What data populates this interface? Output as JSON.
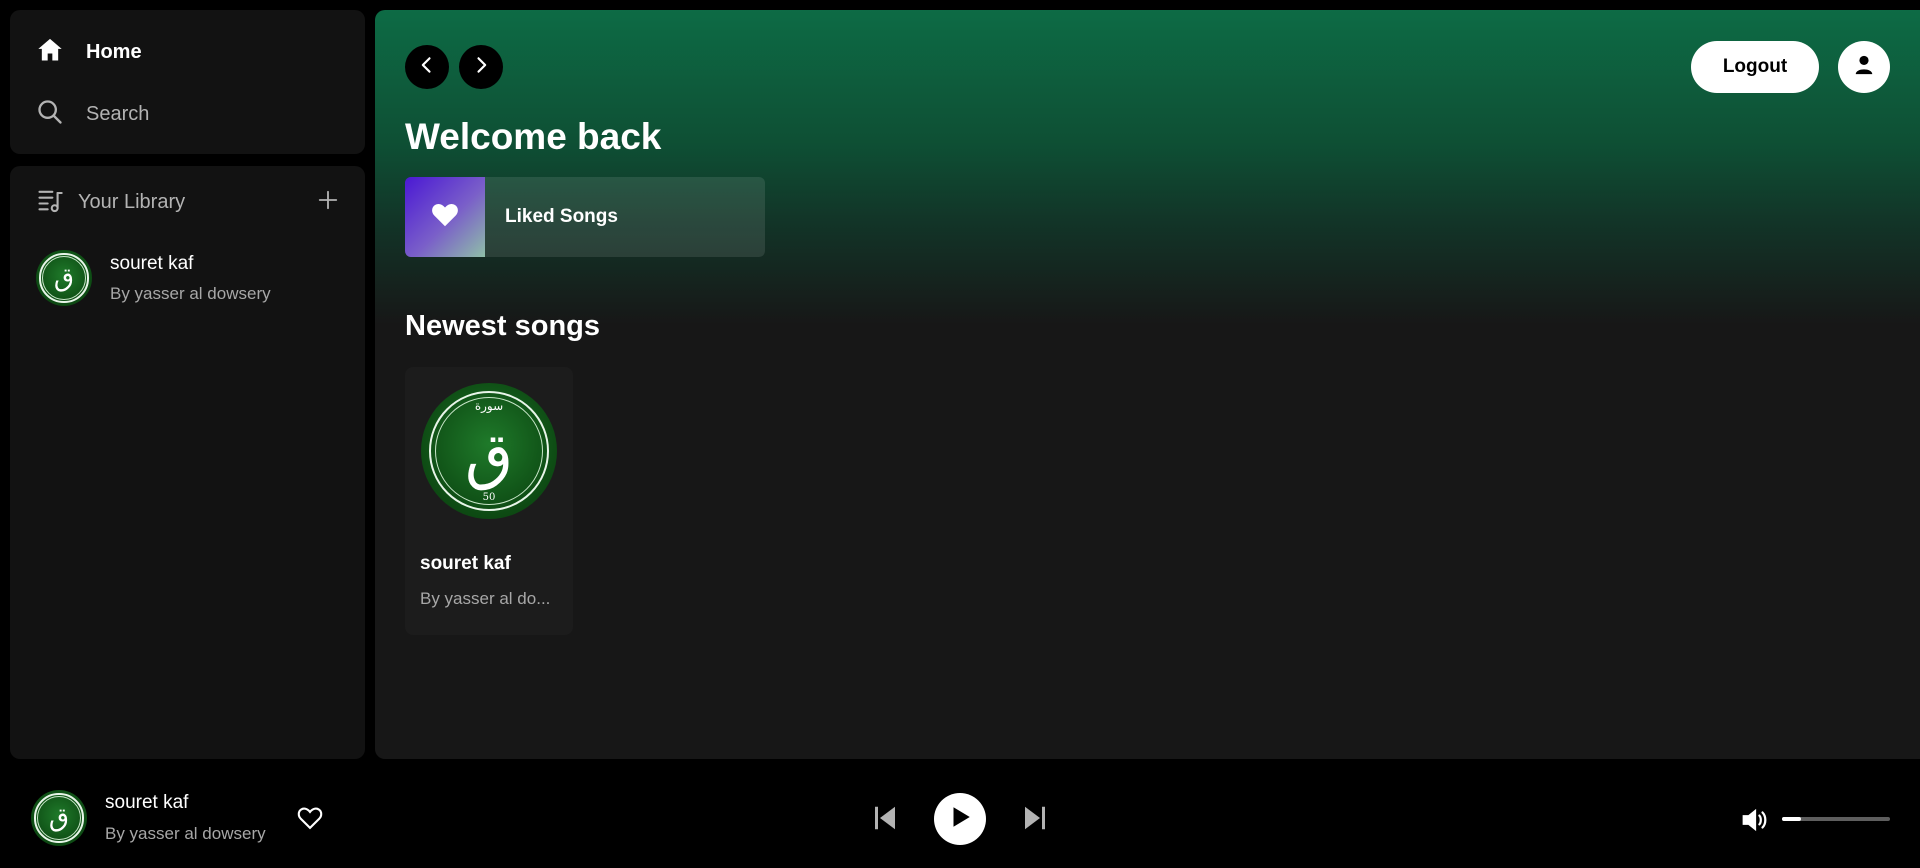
{
  "sidebar": {
    "nav": [
      {
        "label": "Home",
        "icon": "home-icon"
      },
      {
        "label": "Search",
        "icon": "search-icon"
      }
    ],
    "library": {
      "title": "Your Library",
      "items": [
        {
          "title": "souret kaf",
          "subtitle": "By yasser al dowsery"
        }
      ]
    }
  },
  "main": {
    "greeting": "Welcome back",
    "liked_label": "Liked Songs",
    "newest_title": "Newest songs",
    "songs": [
      {
        "title": "souret kaf",
        "subtitle": "By yasser al do..."
      }
    ],
    "logout_label": "Logout"
  },
  "cover": {
    "top_text": "سورة",
    "letter": "ق",
    "number": "50"
  },
  "player": {
    "title": "souret kaf",
    "subtitle": "By yasser al dowsery",
    "volume": 0.18
  },
  "colors": {
    "accent_green": "#0d6b45",
    "surface": "#121212",
    "main_bg": "#171717"
  }
}
